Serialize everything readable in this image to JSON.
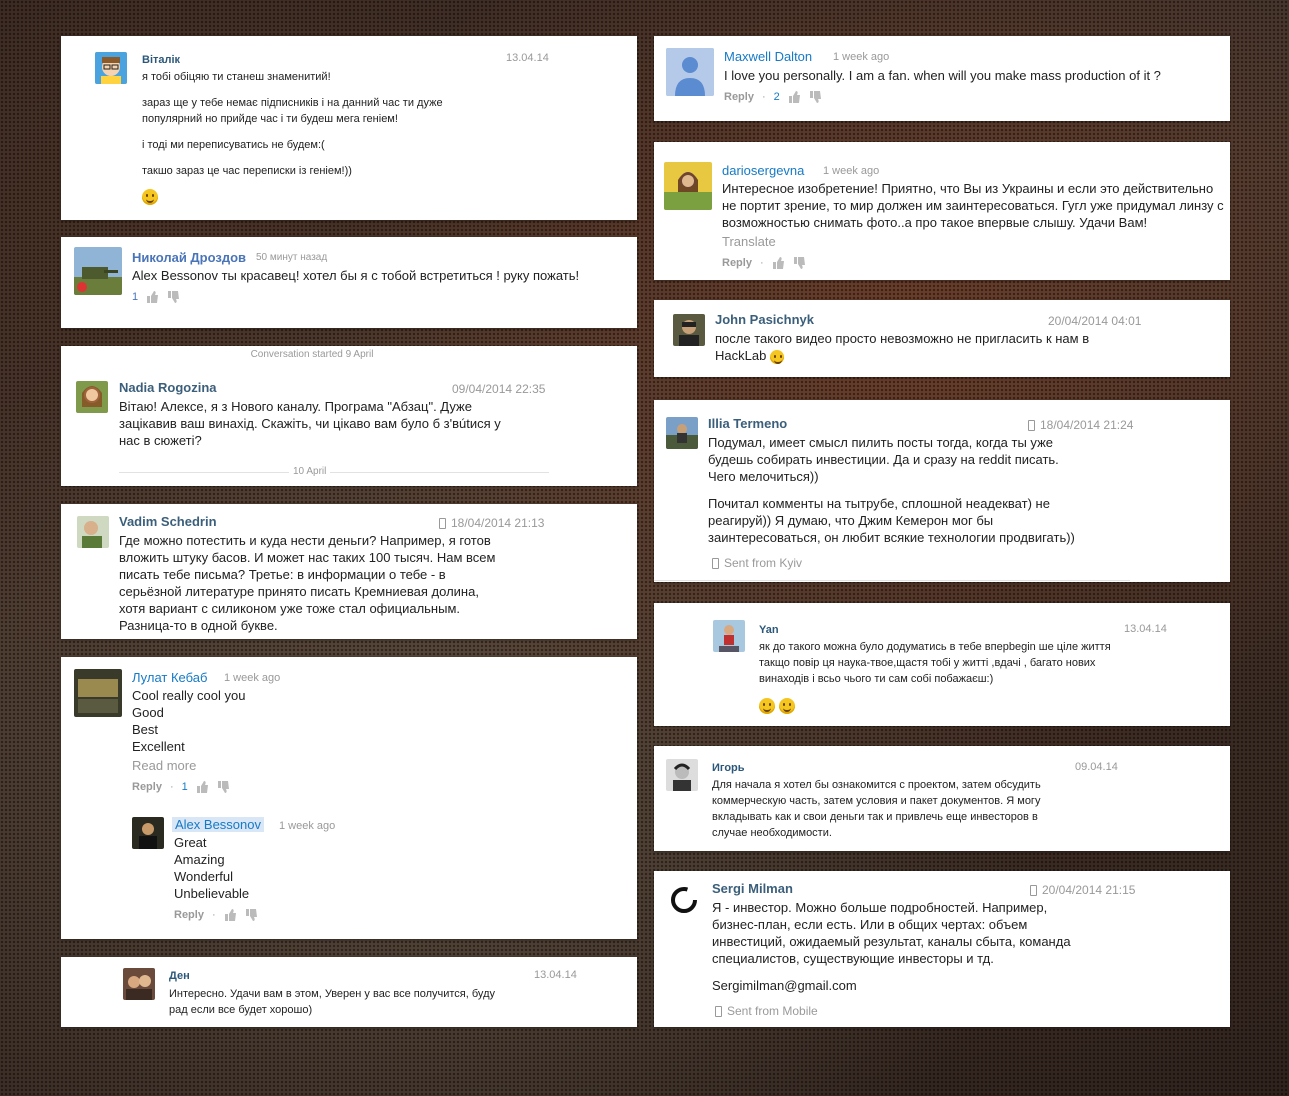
{
  "left": {
    "c1": {
      "name": "Віталік",
      "date": "13.04.14",
      "lines": [
        "я тобі обіцяю ти станеш знаменитий!",
        "зараз ще у тебе немає підписників і на данний час ти дуже популярний но прийде час і ти будеш мега геніем!",
        "і тоді ми переписуватись не будем:(",
        "такшо зараз це час переписки із геніем!))"
      ]
    },
    "c2": {
      "name": "Николай Дроздов",
      "time": "50 минут назад",
      "text": "Alex Bessonov ты красавец! хотел бы я с тобой встретиться ! руку пожать!",
      "likes": "1"
    },
    "c3": {
      "conv": "Conversation started 9 April",
      "name": "Nadia Rogozina",
      "time": "09/04/2014 22:35",
      "text": "Вітаю! Алексе, я з Нового каналу. Програма \"Абзац\". Дуже зацікавив ваш винахід. Скажіть, чи цікаво вам було б з'вútися у нас в сюжеті?",
      "divider": "10 April"
    },
    "c4": {
      "name": "Vadim Schedrin",
      "time": "18/04/2014 21:13",
      "text": "Где можно потестить и куда нести деньги? Например, я готов вложить штуку басов. И может нас таких 100 тысяч. Нам всем писать тебе письма? Третье: в информации о тебе - в серьёзной литературе принято писать Кремниевая долина, хотя вариант с силиконом уже тоже стал официальным. Разница-то в одной букве."
    },
    "c5": {
      "name": "Лулат Кебаб",
      "time": "1 week ago",
      "lines": [
        "Cool really cool you",
        "Good",
        "Best",
        "Excellent"
      ],
      "readmore": "Read more",
      "reply": "Reply",
      "likes": "1",
      "sub": {
        "name": "Alex Bessonov",
        "time": "1 week ago",
        "lines": [
          "Great",
          "Amazing",
          "Wonderful",
          "Unbelievable"
        ],
        "reply": "Reply"
      }
    },
    "c6": {
      "name": "Ден",
      "date": "13.04.14",
      "text": "Интересно. Удачи вам в этом, Уверен у вас все получится, буду рад если все будет хорошо)"
    }
  },
  "right": {
    "r1": {
      "name": "Maxwell Dalton",
      "time": "1 week ago",
      "text": "I  love you personally. I am a fan. when will you make mass production of it ?",
      "reply": "Reply",
      "likes": "2"
    },
    "r2": {
      "name": "dariosergevna",
      "time": "1 week ago",
      "text": "Интересное изобретение! Приятно, что Вы из Украины и если это действительно не портит зрение, то мир должен им заинтересоваться. Гугл уже придумал линзу с возможностью снимать фото..а про такое впервые слышу. Удачи Вам!",
      "translate": "Translate",
      "reply": "Reply"
    },
    "r3": {
      "name": "John Pasichnyk",
      "time": "20/04/2014 04:01",
      "text": "после такого видео просто невозможно не пригласить к нам в HackLab"
    },
    "r4": {
      "name": "Illia Termeno",
      "time": "18/04/2014 21:24",
      "p1": "Подумал, имеет смысл пилить посты тогда, когда ты уже будешь собирать инвестиции. Да и сразу на reddit писать. Чего мелочиться))",
      "p2": "Почитал комменты на тытрубе, сплошной неадекват) не реагируй)) Я думаю, что Джим Кемерон мог бы заинтересоваться, он любит всякие технологии продвигать))",
      "sent": "Sent from Kyiv"
    },
    "r5": {
      "name": "Yan",
      "date": "13.04.14",
      "text": "як до такого можна було додуматись в тебе вперbegin ше ціле життя такщо повір ця наука-твое,щастя тобі у житті ,вдачі , багато нових винаходів і всьо чього ти сам собі побажаєш:)"
    },
    "r6": {
      "name": "Игорь",
      "date": "09.04.14",
      "text": "Для начала я хотел бы ознакомится с проектом, затем обсудить коммерческую часть, затем условия и пакет документов. Я могу вкладывать как и свои деньги так и привлечь еще инвесторов в случае необходимости."
    },
    "r7": {
      "name": "Sergi Milman",
      "time": "20/04/2014 21:15",
      "text": "Я - инвестор. Можно больше подробностей. Например, бизнес-план, если есть. Или в общих чертах: объем инвестиций, ожидаемый результат, каналы сбыта, команда специалистов, существующие инвесторы и тд.",
      "email": "Sergimilman@gmail.com",
      "sent": "Sent from Mobile"
    }
  },
  "colors": {
    "fb_blue": "#4a74b8",
    "vk_blue": "#2b587a",
    "yt_blue": "#167ac6",
    "meta_grey": "#999999"
  }
}
